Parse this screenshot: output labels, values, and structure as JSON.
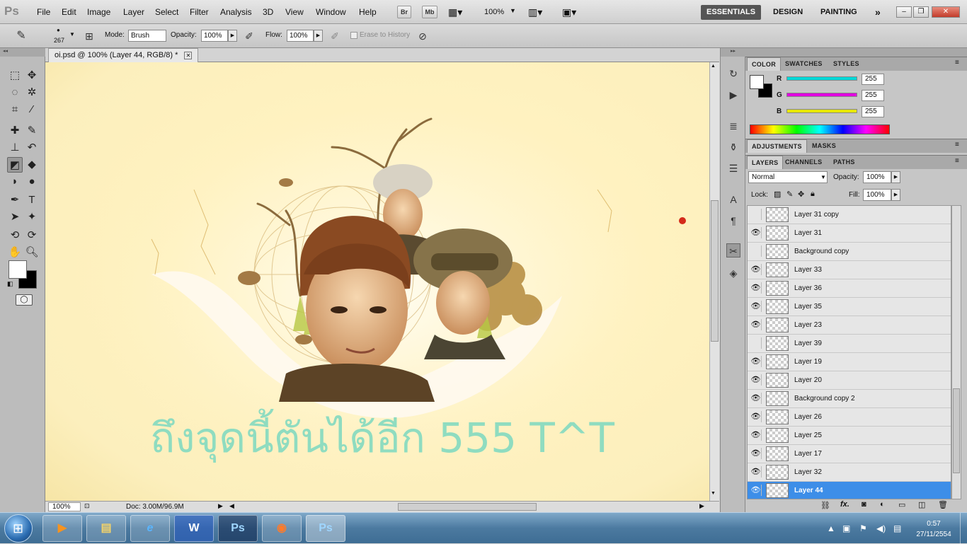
{
  "app": {
    "logo": "Ps",
    "menu": [
      "File",
      "Edit",
      "Image",
      "Layer",
      "Select",
      "Filter",
      "Analysis",
      "3D",
      "View",
      "Window",
      "Help"
    ],
    "bridge_buttons": [
      "Br",
      "Mb"
    ],
    "zoom": "100%",
    "workspaces": [
      "ESSENTIALS",
      "DESIGN",
      "PAINTING"
    ],
    "workspace_more": "»",
    "window_controls": [
      "–",
      "❐",
      "✕"
    ]
  },
  "options": {
    "brush_size": "267",
    "mode_label": "Mode:",
    "mode_value": "Brush",
    "opacity_label": "Opacity:",
    "opacity_value": "100%",
    "flow_label": "Flow:",
    "flow_value": "100%",
    "erase_history": "Erase to History"
  },
  "document": {
    "tab_title": "oi.psd @ 100% (Layer 44, RGB/8) *",
    "tab_close": "✕",
    "canvas_text": "ถึงจุดนี้ตันได้อีก 555 T^T",
    "zoom": "100%",
    "doc_info": "Doc: 3.00M/96.9M"
  },
  "color_panel": {
    "tabs": [
      "COLOR",
      "SWATCHES",
      "STYLES"
    ],
    "channels": [
      {
        "label": "R",
        "value": "255",
        "color": "#00d8d8"
      },
      {
        "label": "G",
        "value": "255",
        "color": "#e000e0"
      },
      {
        "label": "B",
        "value": "255",
        "color": "#e8e800"
      }
    ]
  },
  "adjust_tabs": [
    "ADJUSTMENTS",
    "MASKS"
  ],
  "layers_panel": {
    "tabs": [
      "LAYERS",
      "CHANNELS",
      "PATHS"
    ],
    "blend_mode": "Normal",
    "opacity_label": "Opacity:",
    "opacity_value": "100%",
    "lock_label": "Lock:",
    "fill_label": "Fill:",
    "fill_value": "100%",
    "layers": [
      {
        "name": "Layer 31 copy",
        "visible": false
      },
      {
        "name": "Layer 31",
        "visible": true
      },
      {
        "name": "Background copy",
        "visible": false
      },
      {
        "name": "Layer 33",
        "visible": true
      },
      {
        "name": "Layer 36",
        "visible": true
      },
      {
        "name": "Layer 35",
        "visible": true
      },
      {
        "name": "Layer 23",
        "visible": true
      },
      {
        "name": "Layer 39",
        "visible": false
      },
      {
        "name": "Layer 19",
        "visible": true
      },
      {
        "name": "Layer 20",
        "visible": true
      },
      {
        "name": "Background copy 2",
        "visible": true
      },
      {
        "name": "Layer 26",
        "visible": true
      },
      {
        "name": "Layer 25",
        "visible": true
      },
      {
        "name": "Layer 17",
        "visible": true
      },
      {
        "name": "Layer 32",
        "visible": true
      },
      {
        "name": "Layer 44",
        "visible": true,
        "selected": true
      }
    ],
    "footer_icons": [
      "link-icon",
      "fx-icon",
      "mask-icon",
      "adjustment-icon",
      "group-icon",
      "new-layer-icon",
      "trash-icon"
    ]
  },
  "taskbar": {
    "apps": [
      "media-player-icon",
      "explorer-icon",
      "ie-icon",
      "word-icon",
      "photoshop-icon",
      "firefox-icon",
      "photoshop-icon"
    ],
    "app_labels": [
      "",
      "",
      "e",
      "W",
      "Ps",
      "",
      "Ps"
    ],
    "time": "0:57",
    "date": "27/11/2554"
  },
  "colors": {
    "canvas_text": "#8fdcc0",
    "selected_layer": "#3d8ee8",
    "workspace_active": "#555555"
  }
}
